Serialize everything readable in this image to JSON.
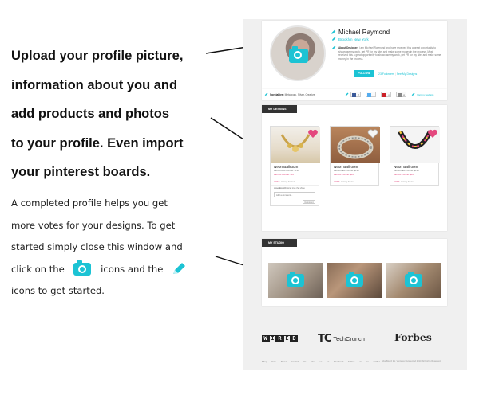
{
  "instructions": {
    "heading_lines": [
      "Upload your profile picture,",
      "information about you and",
      "add products and photos",
      "to your profile. Even import",
      "your pinterest boards."
    ],
    "body_lines": [
      "A completed profile helps you get",
      "more votes for your designs. To get",
      "started simply close this window and"
    ],
    "line4_start": "click on the",
    "line4_middle": "icons and the",
    "line5": "icons to get started."
  },
  "profile": {
    "name": "Michael Raymond",
    "location": "Brooklyn New York",
    "about_label": "About Designer:",
    "about_text": "I am Michael Raymond and have received this a great opportunity to showcase my work, get PR for my site, and make some money in the process. Most received this a great opportunity to showcase my work, get PR for my site, and make some money in the process.",
    "follow_label": "FOLLOW",
    "followers_text": "23 Followers",
    "see_designs_text": "See My Designs",
    "specialties_label": "Specialties:",
    "specialties_value": "Metalwork, Silver, Creative",
    "social": [
      "facebook",
      "twitter",
      "pinterest",
      "website"
    ],
    "visit_text": "Visit my website"
  },
  "designs": {
    "tab_label": "MY DESIGNS",
    "items": [
      {
        "name": "Neon Ballroom",
        "price": "DESIGNER PRICE: $130",
        "retail": "RETAIL PRICE: $10",
        "votes": "VOTE",
        "status": "Voting Ended"
      },
      {
        "name": "Neon Ballroom",
        "price": "DESIGNER PRICE: $130",
        "retail": "RETAIL PRICE: $10",
        "votes": "VOTE",
        "status": "Voting Ended"
      },
      {
        "name": "Neon Ballroom",
        "price": "DESIGNER PRICE: $130",
        "retail": "RETAIL PRICE: $10",
        "votes": "VOTE",
        "status": "Voting Ended"
      }
    ],
    "comment_author": "Jose Bodolli",
    "comment_text": "Nice, love the shine",
    "comment_placeholder": "Add a comment...",
    "comment_button": "Comment"
  },
  "studio": {
    "tab_label": "MY STUDIO"
  },
  "press": {
    "wired": [
      "W",
      "I",
      "R",
      "E",
      "D"
    ],
    "techcrunch_logo": "TC",
    "techcrunch": "TechCrunch",
    "forbes": "Forbes"
  },
  "footer": {
    "links": "Shop Vote About Contact Us Find us on Facebook Follow us on Twitter",
    "copyright": "ShopBoard Inc. Ventures Outsourced 2013. All Rights Reserved."
  },
  "colors": {
    "accent": "#1cc3d4",
    "pink": "#e4487e"
  }
}
